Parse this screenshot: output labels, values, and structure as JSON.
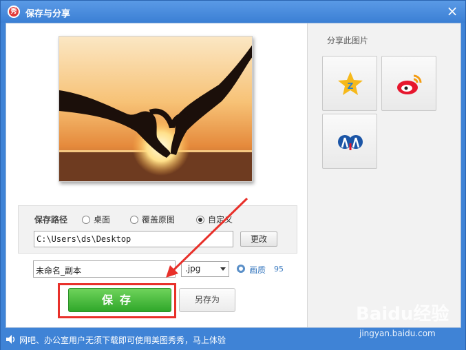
{
  "window": {
    "title": "保存与分享",
    "app_icon_label": "秀"
  },
  "share": {
    "title": "分享此图片",
    "buttons": [
      {
        "name": "qzone",
        "icon": "qzone-star-icon"
      },
      {
        "name": "weibo",
        "icon": "weibo-icon"
      },
      {
        "name": "renren",
        "icon": "renren-icon"
      }
    ]
  },
  "save_path": {
    "label": "保存路径",
    "options": [
      {
        "label": "桌面",
        "selected": false
      },
      {
        "label": "覆盖原图",
        "selected": false
      },
      {
        "label": "自定义",
        "selected": true
      }
    ],
    "path_value": "C:\\Users\\ds\\Desktop",
    "change_button": "更改"
  },
  "file": {
    "name_value": "未命名_副本",
    "extension": ".jpg",
    "quality_label": "画质",
    "quality_value": "95"
  },
  "actions": {
    "save": "保存",
    "save_as": "另存为"
  },
  "status_bar": {
    "message": "网吧、办公室用户无须下载即可使用美图秀秀，马上体验"
  },
  "watermark": {
    "brand": "Baidu经验",
    "url": "jingyan.baidu.com"
  },
  "colors": {
    "accent": "#3f83d6",
    "save_green": "#3fb534",
    "highlight_red": "#e8302a"
  }
}
